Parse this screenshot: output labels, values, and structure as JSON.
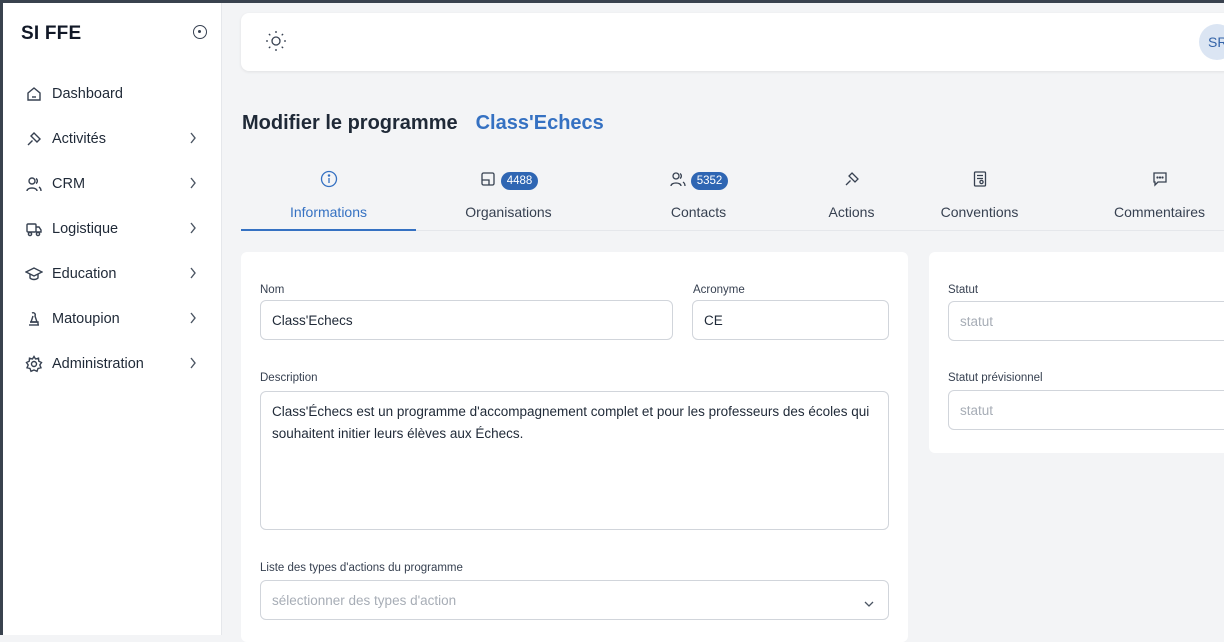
{
  "app": {
    "title": "SI FFE"
  },
  "sidebar": {
    "items": [
      {
        "label": "Dashboard",
        "icon": "home-icon",
        "has_children": false
      },
      {
        "label": "Activités",
        "icon": "gavel-icon",
        "has_children": true
      },
      {
        "label": "CRM",
        "icon": "users-icon",
        "has_children": true
      },
      {
        "label": "Logistique",
        "icon": "truck-icon",
        "has_children": true
      },
      {
        "label": "Education",
        "icon": "graduation-cap-icon",
        "has_children": true
      },
      {
        "label": "Matoupion",
        "icon": "chess-piece-icon",
        "has_children": true
      },
      {
        "label": "Administration",
        "icon": "gear-icon",
        "has_children": true
      }
    ]
  },
  "header": {
    "avatar_initials": "SR",
    "theme_icon": "sun-icon"
  },
  "page": {
    "title": "Modifier le programme",
    "program_name": "Class'Echecs"
  },
  "tabs": [
    {
      "label": "Informations",
      "icon": "info-icon",
      "count": "",
      "active": true
    },
    {
      "label": "Organisations",
      "icon": "building-icon",
      "count": "4488",
      "active": false
    },
    {
      "label": "Contacts",
      "icon": "users-icon",
      "count": "5352",
      "active": false
    },
    {
      "label": "Actions",
      "icon": "gavel-icon",
      "count": "",
      "active": false
    },
    {
      "label": "Conventions",
      "icon": "document-icon",
      "count": "",
      "active": false
    },
    {
      "label": "Commentaires",
      "icon": "comment-icon",
      "count": "",
      "active": false
    }
  ],
  "form": {
    "nom": {
      "label": "Nom",
      "value": "Class'Echecs"
    },
    "acronyme": {
      "label": "Acronyme",
      "value": "CE"
    },
    "description": {
      "label": "Description",
      "value": "Class'Échecs est un programme d'accompagnement complet et pour les professeurs des écoles qui souhaitent initier leurs élèves aux Échecs."
    },
    "types_actions": {
      "label": "Liste des types d'actions du programme",
      "placeholder": "sélectionner des types d'action"
    }
  },
  "status": {
    "statut": {
      "label": "Statut",
      "placeholder": "statut"
    },
    "statut_previsionnel": {
      "label": "Statut prévisionnel",
      "placeholder": "statut"
    }
  },
  "colors": {
    "accent": "#3571c2",
    "badge": "#2f66b3",
    "background": "#f3f4f6"
  }
}
